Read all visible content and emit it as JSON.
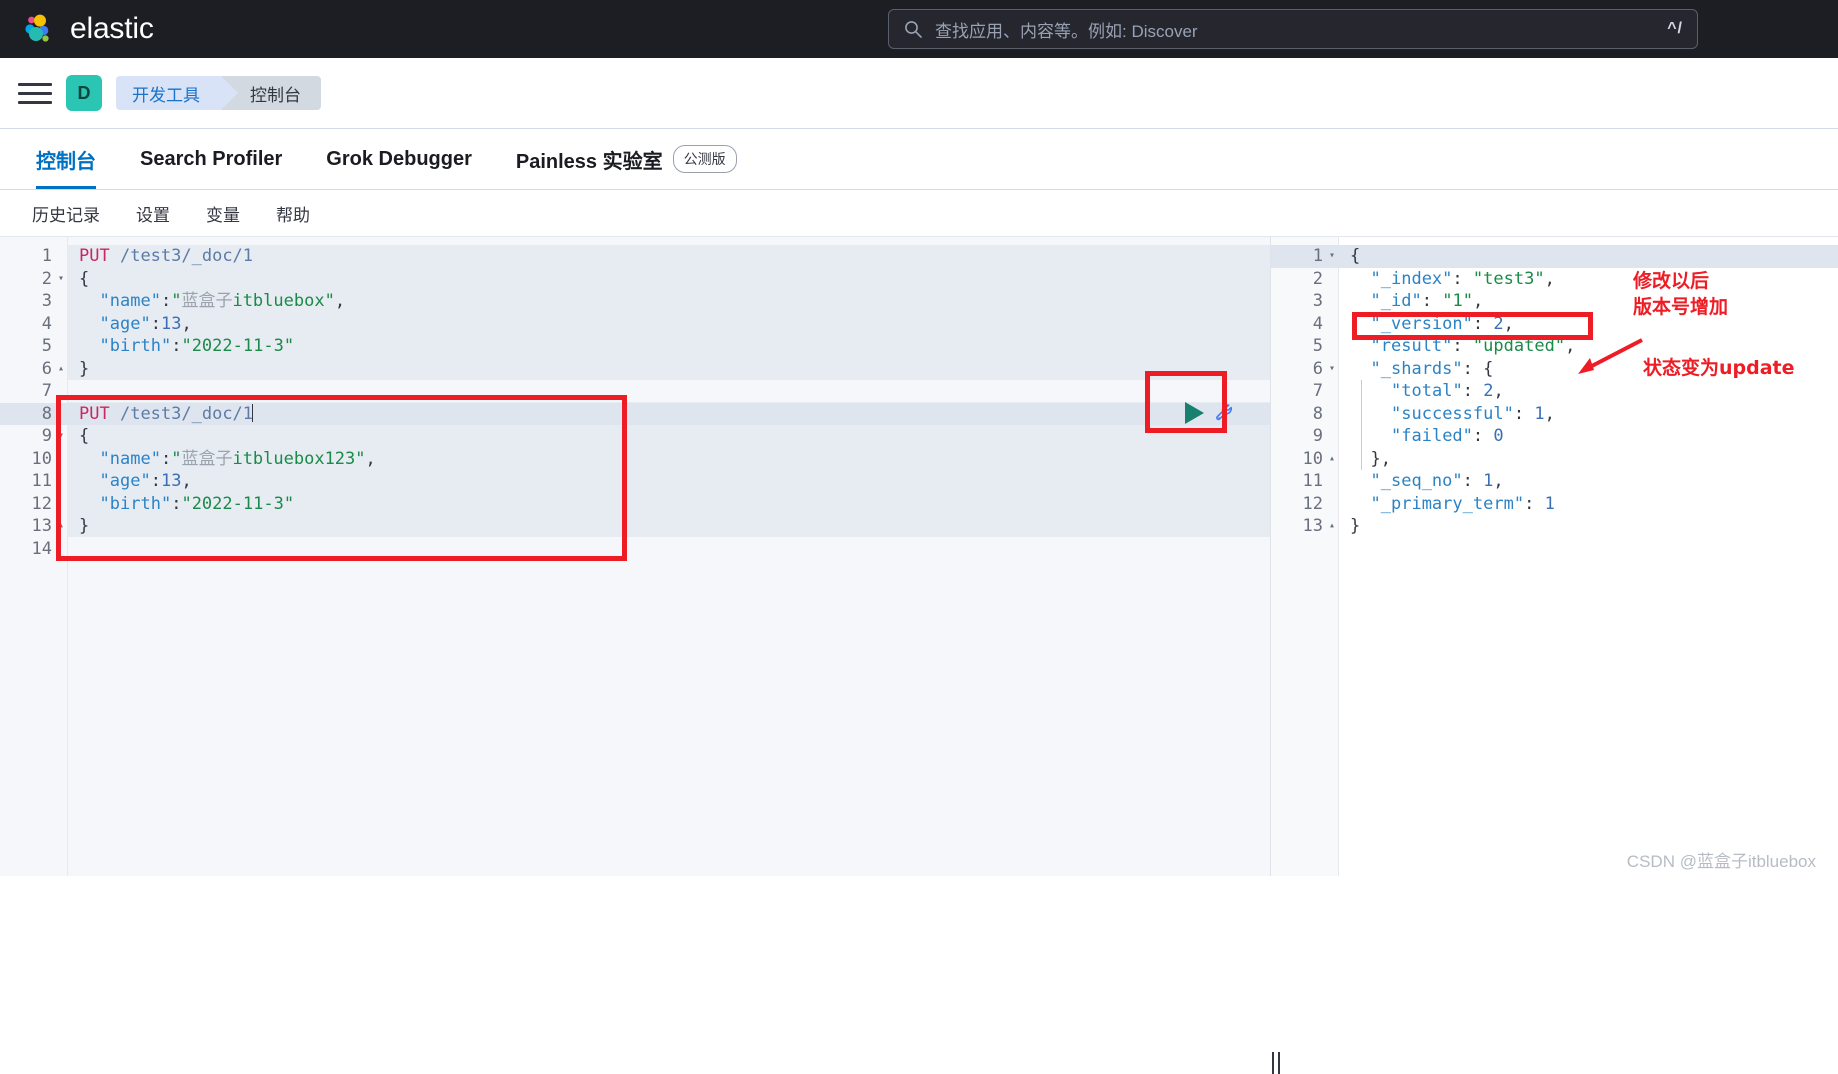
{
  "header": {
    "brand": "elastic",
    "logo_icon": "elastic-logo-icon",
    "search": {
      "icon": "search-icon",
      "placeholder": "查找应用、内容等。例如: Discover",
      "value": "",
      "shortcut": "^/"
    }
  },
  "breadcrumb_bar": {
    "menu_icon": "hamburger-menu-icon",
    "space_avatar": "D",
    "crumbs": [
      {
        "label": "开发工具"
      },
      {
        "label": "控制台"
      }
    ]
  },
  "app_tabs": [
    {
      "label": "控制台",
      "active": true,
      "badge": ""
    },
    {
      "label": "Search Profiler",
      "active": false,
      "badge": ""
    },
    {
      "label": "Grok Debugger",
      "active": false,
      "badge": ""
    },
    {
      "label": "Painless 实验室",
      "active": false,
      "badge": "公测版"
    }
  ],
  "console_menu": [
    {
      "label": "历史记录"
    },
    {
      "label": "设置"
    },
    {
      "label": "变量"
    },
    {
      "label": "帮助"
    }
  ],
  "editor": {
    "run_button_icon": "play-run-icon",
    "wrench_icon": "wrench-icon",
    "resize_handle_icon": "resize-handle-icon",
    "request_lines": [
      {
        "n": "1",
        "fold": "",
        "text": "PUT /test3/_doc/1"
      },
      {
        "n": "2",
        "fold": "▾",
        "text": "{"
      },
      {
        "n": "3",
        "fold": "",
        "text": "  \"name\":\"蓝盒子itbluebox\","
      },
      {
        "n": "4",
        "fold": "",
        "text": "  \"age\":13,"
      },
      {
        "n": "5",
        "fold": "",
        "text": "  \"birth\":\"2022-11-3\""
      },
      {
        "n": "6",
        "fold": "▴",
        "text": "}"
      },
      {
        "n": "7",
        "fold": "",
        "text": ""
      },
      {
        "n": "8",
        "fold": "",
        "text": "PUT /test3/_doc/1"
      },
      {
        "n": "9",
        "fold": "▾",
        "text": "{"
      },
      {
        "n": "10",
        "fold": "",
        "text": "  \"name\":\"蓝盒子itbluebox123\","
      },
      {
        "n": "11",
        "fold": "",
        "text": "  \"age\":13,"
      },
      {
        "n": "12",
        "fold": "",
        "text": "  \"birth\":\"2022-11-3\""
      },
      {
        "n": "13",
        "fold": "▴",
        "text": "}"
      },
      {
        "n": "14",
        "fold": "",
        "text": ""
      }
    ],
    "response_lines": [
      {
        "n": "1",
        "fold": "▾",
        "text": "{"
      },
      {
        "n": "2",
        "fold": "",
        "text": "  \"_index\": \"test3\","
      },
      {
        "n": "3",
        "fold": "",
        "text": "  \"_id\": \"1\","
      },
      {
        "n": "4",
        "fold": "",
        "text": "  \"_version\": 2,"
      },
      {
        "n": "5",
        "fold": "",
        "text": "  \"result\": \"updated\","
      },
      {
        "n": "6",
        "fold": "▾",
        "text": "  \"_shards\": {"
      },
      {
        "n": "7",
        "fold": "",
        "text": "    \"total\": 2,"
      },
      {
        "n": "8",
        "fold": "",
        "text": "    \"successful\": 1,"
      },
      {
        "n": "9",
        "fold": "",
        "text": "    \"failed\": 0"
      },
      {
        "n": "10",
        "fold": "▴",
        "text": "  },"
      },
      {
        "n": "11",
        "fold": "",
        "text": "  \"_seq_no\": 1,"
      },
      {
        "n": "12",
        "fold": "",
        "text": "  \"_primary_term\": 1"
      },
      {
        "n": "13",
        "fold": "▴",
        "text": "}"
      }
    ]
  },
  "annotations": {
    "note_version": "修改以后\n版本号增加",
    "note_result": "状态变为update",
    "color": "#ee1c25"
  },
  "watermark": "CSDN @蓝盒子itbluebox"
}
